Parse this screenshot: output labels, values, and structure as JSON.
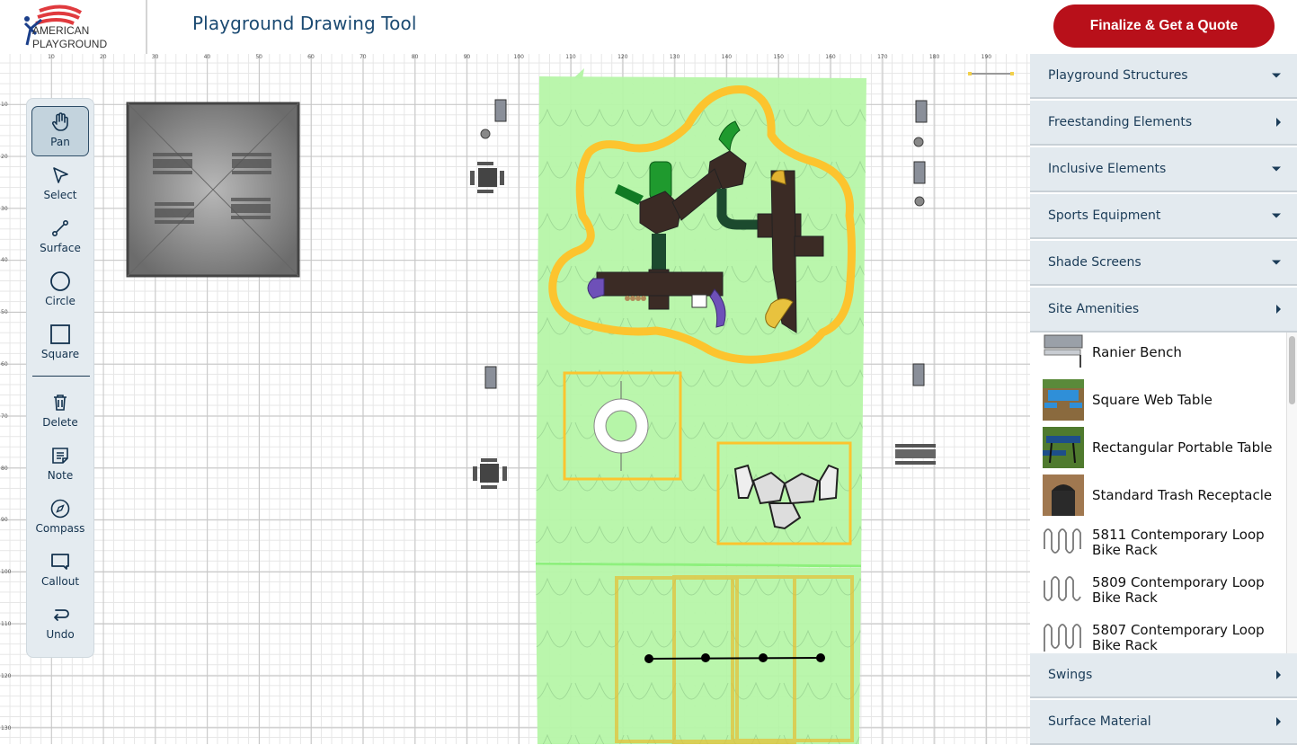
{
  "header": {
    "logo_line1": "AMERICAN",
    "logo_line2": "PLAYGROUND",
    "title": "Playground Drawing Tool",
    "quote_button": "Finalize & Get a Quote"
  },
  "colors": {
    "accent_red": "#b8101a",
    "title_blue": "#1b4a72",
    "surface_green": "#b6f5a8",
    "outline_orange": "#fcc42e",
    "panel_bg": "#e3eaef"
  },
  "ruler": {
    "x_ticks": [
      "10",
      "20",
      "30",
      "40",
      "50",
      "60",
      "70",
      "80",
      "90",
      "100",
      "110",
      "120",
      "130",
      "140",
      "150",
      "160",
      "170",
      "180",
      "190"
    ],
    "y_ticks": [
      "10",
      "20",
      "30",
      "40",
      "50",
      "60",
      "70",
      "80",
      "90",
      "100",
      "110",
      "120",
      "130"
    ]
  },
  "toolbar": {
    "tools": [
      {
        "label": "Pan",
        "icon": "hand-icon",
        "active": true
      },
      {
        "label": "Select",
        "icon": "pointer-icon",
        "active": false
      },
      {
        "label": "Surface",
        "icon": "surface-line-icon",
        "active": false
      },
      {
        "label": "Circle",
        "icon": "circle-icon",
        "active": false
      },
      {
        "label": "Square",
        "icon": "square-icon",
        "active": false
      },
      {
        "label": "Delete",
        "icon": "trash-icon",
        "active": false
      },
      {
        "label": "Note",
        "icon": "note-icon",
        "active": false
      },
      {
        "label": "Compass",
        "icon": "compass-icon",
        "active": false
      },
      {
        "label": "Callout",
        "icon": "callout-icon",
        "active": false
      },
      {
        "label": "Undo",
        "icon": "undo-icon",
        "active": false
      }
    ]
  },
  "sidebar": {
    "categories_top": [
      {
        "label": "Playground Structures",
        "state": "collapsed-down"
      },
      {
        "label": "Freestanding Elements",
        "state": "right"
      },
      {
        "label": "Inclusive Elements",
        "state": "collapsed-down"
      },
      {
        "label": "Sports Equipment",
        "state": "collapsed-down"
      },
      {
        "label": "Shade Screens",
        "state": "collapsed-down"
      },
      {
        "label": "Site Amenities",
        "state": "right"
      }
    ],
    "site_amenities_items": [
      {
        "name": "Ranier Bench",
        "thumb": "bench"
      },
      {
        "name": "Square Web Table",
        "thumb": "square-table"
      },
      {
        "name": "Rectangular Portable Table",
        "thumb": "rect-table"
      },
      {
        "name": "Standard Trash Receptacle",
        "thumb": "trash-can"
      },
      {
        "name": "5811 Contemporary Loop Bike Rack",
        "thumb": "bike-rack"
      },
      {
        "name": "5809 Contemporary Loop Bike Rack",
        "thumb": "bike-rack"
      },
      {
        "name": "5807 Contemporary Loop Bike Rack",
        "thumb": "bike-rack"
      }
    ],
    "categories_bottom": [
      {
        "label": "Swings",
        "state": "right"
      },
      {
        "label": "Surface Material",
        "state": "right"
      }
    ]
  }
}
